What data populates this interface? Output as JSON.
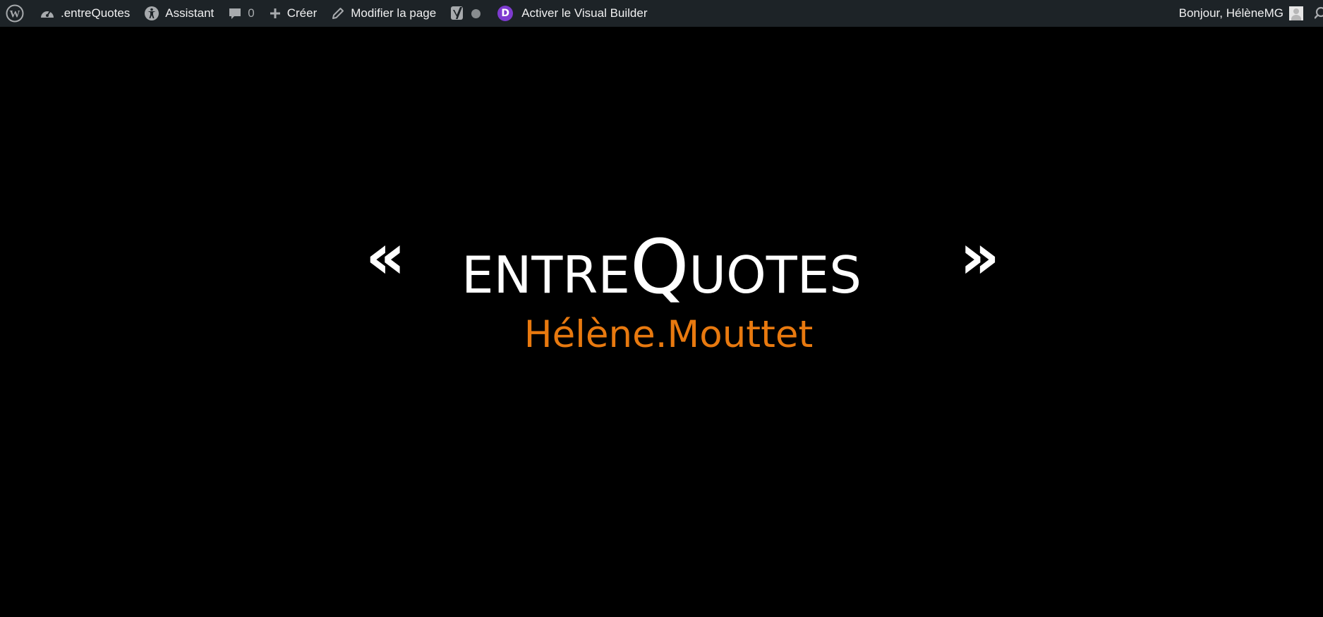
{
  "admin_bar": {
    "wp_logo_icon": "wordpress-logo-icon",
    "site_name": ".entreQuotes",
    "site_icon": "dashboard-icon",
    "assistant_label": "Assistant",
    "assistant_icon": "accessibility-icon",
    "comments_count": "0",
    "comments_icon": "comment-icon",
    "create_label": "Créer",
    "create_icon": "plus-icon",
    "edit_page_label": "Modifier la page",
    "edit_icon": "pencil-icon",
    "seo_icon": "yoast-icon",
    "seo_status_icon": "status-dot-icon",
    "divi_badge_text": "D",
    "visual_builder_label": "Activer le Visual Builder",
    "greeting": "Bonjour, HélèneMG",
    "avatar_icon": "user-avatar-icon",
    "search_icon": "search-icon",
    "colors": {
      "bar_background": "#1d2327",
      "text": "#f0f0f1",
      "icon": "#a7aaad",
      "divi_purple": "#7e3bd0"
    }
  },
  "hero": {
    "quote_open": "«",
    "quote_close": "»",
    "brand_part1": "ENTRE",
    "brand_part2": "Q",
    "brand_part3": "UOTES",
    "subtitle": "Hélène.Mouttet",
    "colors": {
      "background": "#000000",
      "brand": "#ffffff",
      "subtitle": "#e8790f"
    }
  }
}
